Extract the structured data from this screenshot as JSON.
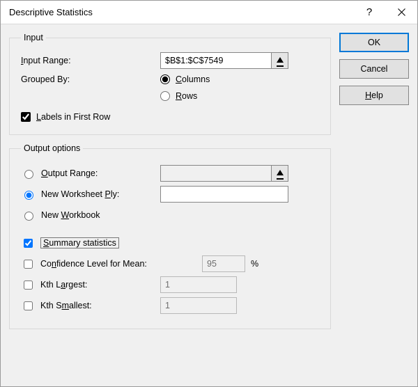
{
  "window": {
    "title": "Descriptive Statistics"
  },
  "buttons": {
    "ok": "OK",
    "cancel": "Cancel",
    "help_pre": "",
    "help_u": "H",
    "help_post": "elp"
  },
  "input_group": {
    "legend": "Input",
    "input_range": {
      "label_pre": "",
      "label_u": "I",
      "label_post": "nput Range:",
      "value": "$B$1:$C$7549"
    },
    "grouped_by": {
      "label": "Grouped By:",
      "columns_u": "C",
      "columns_post": "olumns",
      "rows_u": "R",
      "rows_post": "ows",
      "value": "columns"
    },
    "labels_first_row": {
      "label_u": "L",
      "label_post": "abels in First Row",
      "checked": true
    }
  },
  "output_group": {
    "legend": "Output options",
    "output_range": {
      "label_u": "O",
      "label_post": "utput Range:",
      "value": ""
    },
    "new_worksheet": {
      "label_pre": "New Worksheet ",
      "label_u": "P",
      "label_post": "ly:",
      "value": ""
    },
    "new_workbook": {
      "label_pre": "New ",
      "label_u": "W",
      "label_post": "orkbook"
    },
    "output_dest": "new_worksheet",
    "summary_stats": {
      "label_u": "S",
      "label_post": "ummary statistics",
      "checked": true
    },
    "confidence": {
      "label_pre": "Co",
      "label_u": "n",
      "label_post": "fidence Level for Mean:",
      "value": "95",
      "suffix": "%",
      "checked": false
    },
    "kth_largest": {
      "label_pre": "Kth L",
      "label_u": "a",
      "label_post": "rgest:",
      "value": "1",
      "checked": false
    },
    "kth_smallest": {
      "label_pre": "Kth S",
      "label_u": "m",
      "label_post": "allest:",
      "value": "1",
      "checked": false
    }
  }
}
